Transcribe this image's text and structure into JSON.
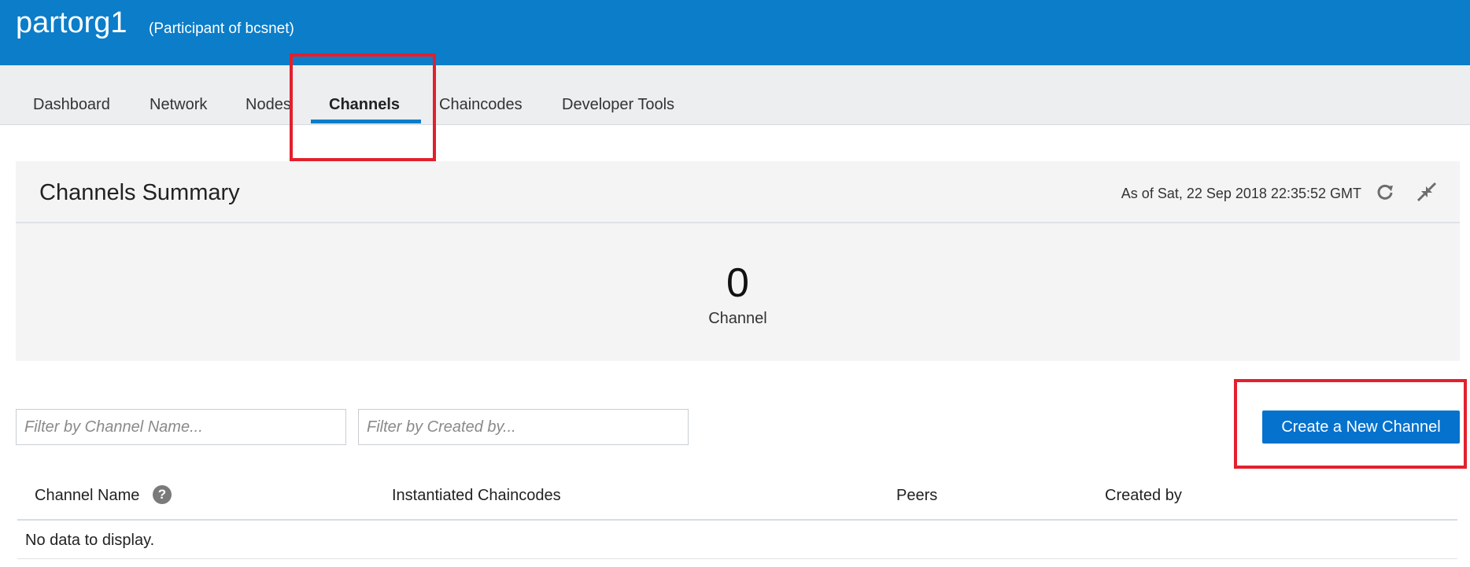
{
  "header": {
    "title": "partorg1",
    "subtitle": "(Participant of bcsnet)"
  },
  "tabs": [
    {
      "label": "Dashboard",
      "active": false
    },
    {
      "label": "Network",
      "active": false
    },
    {
      "label": "Nodes",
      "active": false
    },
    {
      "label": "Channels",
      "active": true
    },
    {
      "label": "Chaincodes",
      "active": false
    },
    {
      "label": "Developer Tools",
      "active": false
    }
  ],
  "summary": {
    "title": "Channels Summary",
    "as_of": "As of Sat, 22 Sep 2018 22:35:52 GMT",
    "count": "0",
    "count_label": "Channel",
    "icons": [
      "refresh-icon",
      "collapse-icon"
    ]
  },
  "filters": {
    "channel_name_placeholder": "Filter by Channel Name...",
    "channel_name_value": "",
    "created_by_placeholder": "Filter by Created by...",
    "created_by_value": ""
  },
  "actions": {
    "create_channel_label": "Create a New Channel"
  },
  "table": {
    "columns": [
      "Channel Name",
      "Instantiated Chaincodes",
      "Peers",
      "Created by"
    ],
    "help_glyph": "?",
    "rows": [],
    "empty_text": "No data to display."
  },
  "colors": {
    "header_bg": "#0b7dc9",
    "tab_active_underline": "#0b7dc9",
    "primary_button": "#0572ce",
    "annotation_box": "#e3202c"
  }
}
